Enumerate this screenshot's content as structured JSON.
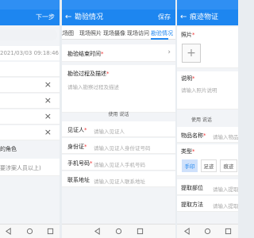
{
  "colors": {
    "primary": "#1d86f0",
    "background": "#f2f4f7",
    "required": "#e33333"
  },
  "panel1": {
    "header_action": "下一步",
    "date_value": "2021/03/03 09:18:46",
    "role_text": "的角色",
    "hint_text": "要涉案人员以上)",
    "close_icon": "×"
  },
  "panel2": {
    "back_icon": "←",
    "title": "勘验情况",
    "save_label": "保存",
    "tabs": [
      "现场图",
      "现场照片",
      "现场摄像",
      "现场访问",
      "勘验情况"
    ],
    "end_time_label": "勘验结束时间",
    "summary_label": "勘验过程及描述",
    "summary_placeholder": "请输入勘察过程及描述",
    "template_btn": "使用  说话",
    "witness_label": "见证人",
    "witness_placeholder": "请输入见证人",
    "id_label": "身份证",
    "id_placeholder": "请输入见证人身份证号码",
    "phone_label": "手机号码",
    "phone_placeholder": "请输入见证人手机号码",
    "address_label": "联系地址",
    "address_placeholder": "请输入见证人联系地址"
  },
  "panel3": {
    "back_icon": "←",
    "title": "痕迹物证",
    "photo_label": "照片",
    "add_icon": "+",
    "desc_label": "说明",
    "desc_placeholder": "请输入照片说明",
    "template_btn": "使用  说话",
    "item_label": "物品名称",
    "item_placeholder": "请输入物品",
    "type_label": "类型",
    "type_options": [
      "手印",
      "足迹",
      "痕迹"
    ],
    "part_label": "提取部位",
    "part_placeholder": "请输入提取部",
    "method_label": "提取方法",
    "method_placeholder": "请输入提取方"
  }
}
